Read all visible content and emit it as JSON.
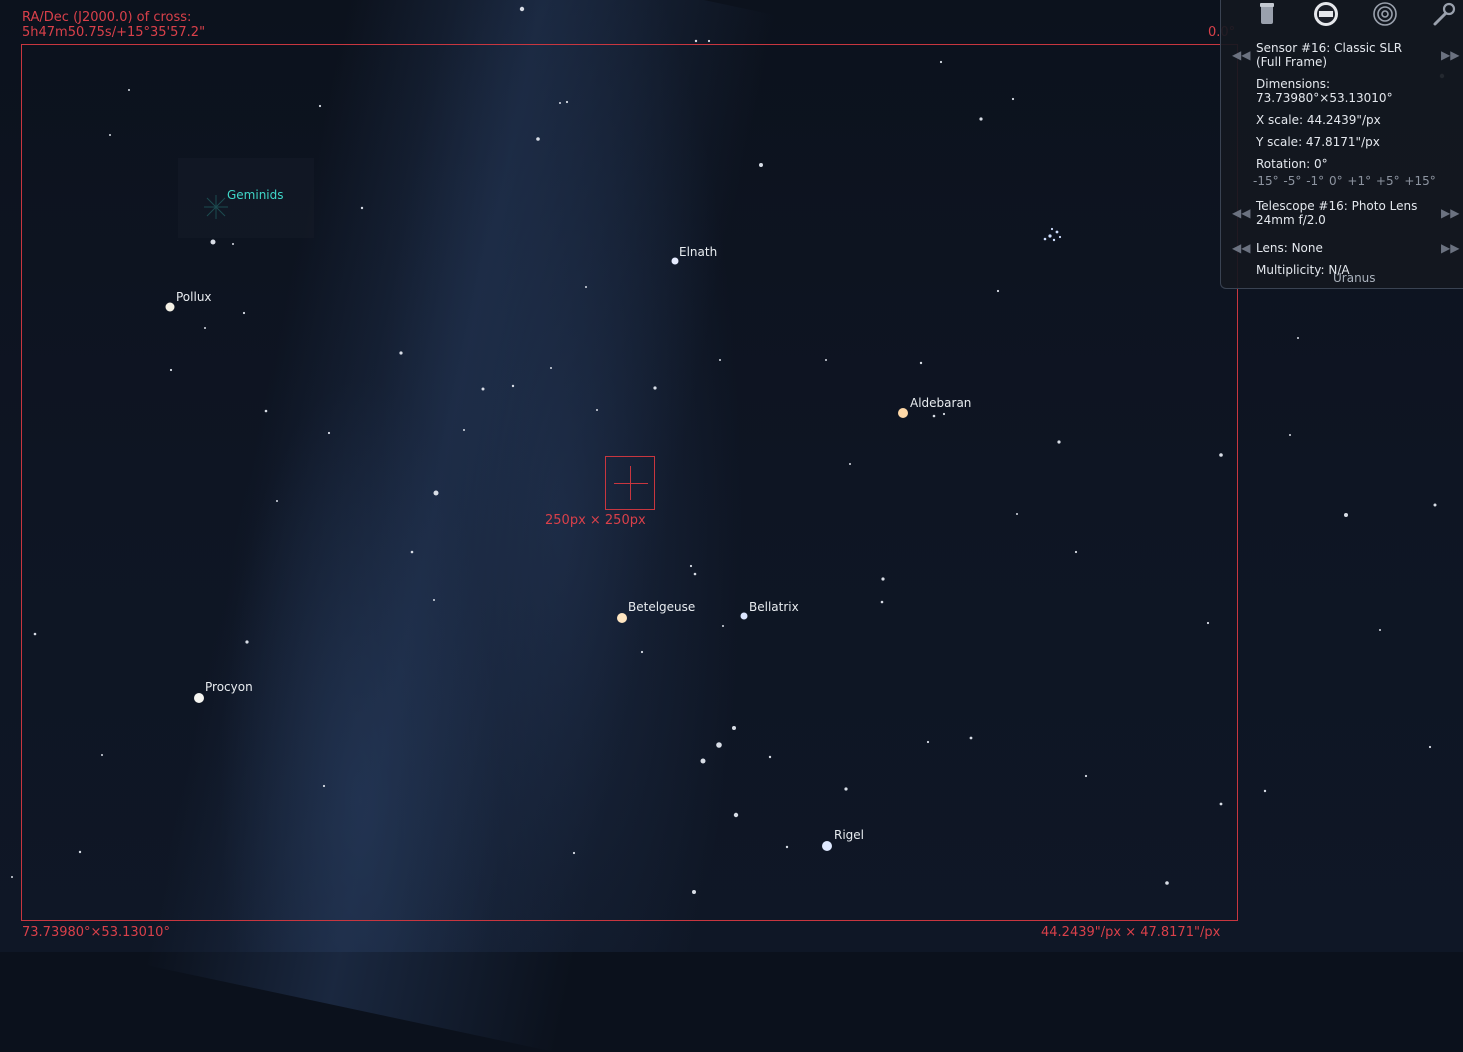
{
  "overlay": {
    "cross_coords_label": "RA/Dec (J2000.0) of cross:",
    "cross_coords_value": "5h47m50.75s/+15°35'57.2\"",
    "rotation_angle": "0.0°",
    "ccd_size_label": "250px × 250px",
    "fov_label": "73.73980°×53.13010°",
    "scale_label": "44.2439\"/px × 47.8171\"/px"
  },
  "sky_labels": {
    "geminids": "Geminids",
    "pollux": "Pollux",
    "elnath": "Elnath",
    "aldebaran": "Aldebaran",
    "betelgeuse": "Betelgeuse",
    "bellatrix": "Bellatrix",
    "procyon": "Procyon",
    "rigel": "Rigel",
    "uranus": "Uranus"
  },
  "panel": {
    "icons": [
      "telescope-icon",
      "sensor-icon",
      "target-icon",
      "wrench-icon"
    ],
    "sensor_line1": "Sensor #16: Classic SLR",
    "sensor_line2": "(Full Frame)",
    "dimensions_label": "Dimensions:",
    "dimensions_value": "73.73980°×53.13010°",
    "x_scale": "X scale: 44.2439\"/px",
    "y_scale": "Y scale: 47.8171\"/px",
    "rotation": "Rotation: 0°",
    "rotation_steps": "-15° -5° -1° 0° +1° +5° +15°",
    "telescope_line1": "Telescope #16: Photo Lens",
    "telescope_line2": "24mm f/2.0",
    "lens": "Lens: None",
    "multiplicity": "Multiplicity: N/A"
  },
  "colors": {
    "overlay_red": "#d9404a",
    "geminids_cyan": "#3fd6c8",
    "star_label": "#e8ecf0"
  }
}
